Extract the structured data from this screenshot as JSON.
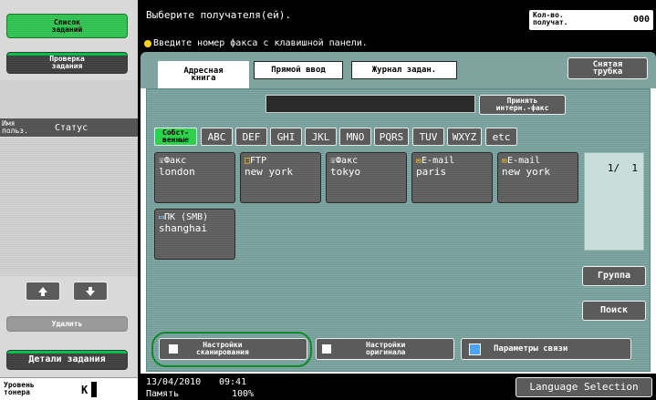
{
  "left": {
    "job_list": "Список\nзаданий",
    "check_job": "Проверка\nзадания",
    "col_user": "Имя\nпольз.",
    "col_status": "Статус",
    "delete": "Удалить",
    "job_details": "Детали задания",
    "toner_label": "Уровень\nтонера",
    "toner_color": "K"
  },
  "header": {
    "title": "Выберите получателя(ей).",
    "hint": "Введите номер факса с клавишной панели.",
    "count_label": "Кол-во.\nполучат.",
    "count_value": "000"
  },
  "tabs": {
    "address_book": "Адресная\nкнига",
    "direct_input": "Прямой ввод",
    "job_log": "Журнал задан.",
    "off_hook": "Снятая\nтрубка"
  },
  "search_field": {
    "value": ""
  },
  "internet_fax": "Принять\nинтерн.-факс",
  "index": [
    "Собст-\nвенные",
    "ABC",
    "DEF",
    "GHI",
    "JKL",
    "MNO",
    "PQRS",
    "TUV",
    "WXYZ",
    "etc"
  ],
  "destinations": [
    {
      "type": "Факс",
      "name": "london",
      "icon": "fax-icon"
    },
    {
      "type": "FTP",
      "name": "new york",
      "icon": "ftp-icon"
    },
    {
      "type": "Факс",
      "name": "tokyo",
      "icon": "fax-icon"
    },
    {
      "type": "E-mail",
      "name": "paris",
      "icon": "email-icon"
    },
    {
      "type": "E-mail",
      "name": "new york",
      "icon": "email-icon"
    },
    {
      "type": "ПК (SMB)",
      "name": "shanghai",
      "icon": "pc-icon"
    }
  ],
  "pager": {
    "page": "1/  1"
  },
  "side": {
    "group": "Группа",
    "search": "Поиск"
  },
  "bottom": {
    "scan_settings": "Настройки\nсканирования",
    "original_settings": "Настройки\nоригинала",
    "comm_settings": "Параметры связи"
  },
  "status": {
    "date": "13/04/2010",
    "time": "09:41",
    "memory_label": "Память",
    "memory_value": "100%",
    "language": "Language Selection"
  },
  "colors": {
    "accent_green": "#3ccc5c",
    "panel_teal": "#7fa39f",
    "border_teal": "#5b8a87",
    "selected_green": "#2ed14b"
  }
}
